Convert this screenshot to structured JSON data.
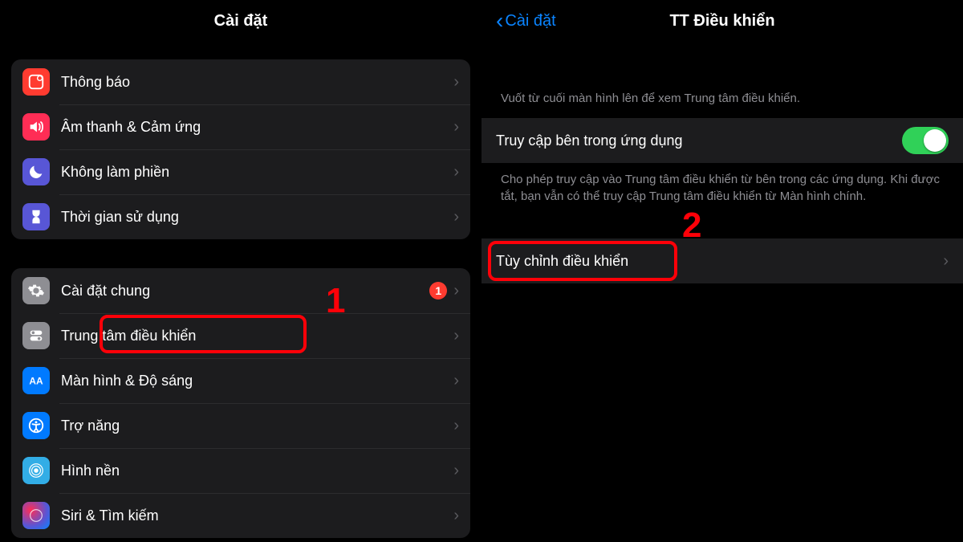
{
  "left": {
    "title": "Cài đặt",
    "group1": [
      {
        "label": "Thông báo"
      },
      {
        "label": "Âm thanh & Cảm ứng"
      },
      {
        "label": "Không làm phiền"
      },
      {
        "label": "Thời gian sử dụng"
      }
    ],
    "group2": [
      {
        "label": "Cài đặt chung",
        "badge": "1"
      },
      {
        "label": "Trung tâm điều khiển"
      },
      {
        "label": "Màn hình & Độ sáng"
      },
      {
        "label": "Trợ năng"
      },
      {
        "label": "Hình nền"
      },
      {
        "label": "Siri & Tìm kiếm"
      }
    ]
  },
  "right": {
    "back": "Cài đặt",
    "title": "TT Điều khiển",
    "hint_top": "Vuốt từ cuối màn hình lên để xem Trung tâm điều khiển.",
    "toggle_label": "Truy cập bên trong ứng dụng",
    "hint_bottom": "Cho phép truy cập vào Trung tâm điều khiển từ bên trong các ứng dụng. Khi được tắt, bạn vẫn có thể truy cập Trung tâm điều khiển từ Màn hình chính.",
    "customize_label": "Tùy chỉnh điều khiển"
  },
  "annotations": {
    "step1": "1",
    "step2": "2"
  }
}
